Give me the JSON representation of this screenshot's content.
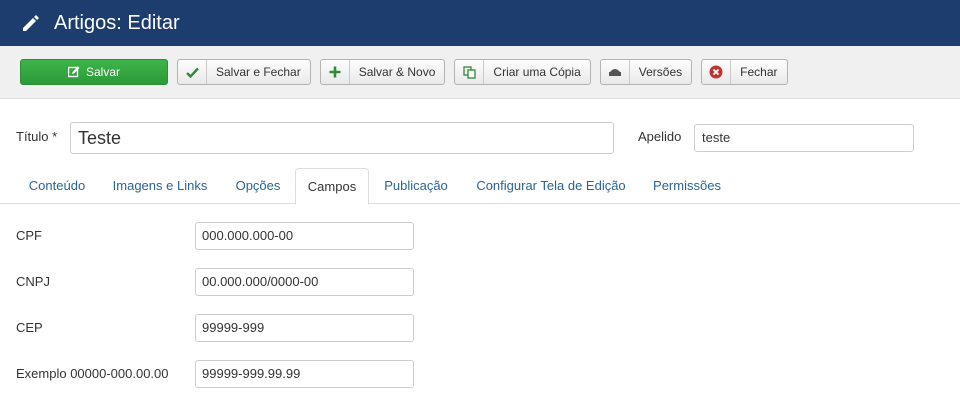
{
  "header": {
    "title": "Artigos: Editar",
    "icon": "pencil-icon"
  },
  "toolbar": {
    "save": "Salvar",
    "save_close": "Salvar e Fechar",
    "save_new": "Salvar & Novo",
    "save_copy": "Criar uma Cópia",
    "versions": "Versões",
    "close": "Fechar"
  },
  "form": {
    "title_label": "Título *",
    "title_value": "Teste",
    "alias_label": "Apelido",
    "alias_value": "teste"
  },
  "tabs": [
    {
      "label": "Conteúdo"
    },
    {
      "label": "Imagens e Links"
    },
    {
      "label": "Opções"
    },
    {
      "label": "Campos",
      "active": true
    },
    {
      "label": "Publicação"
    },
    {
      "label": "Configurar Tela de Edição"
    },
    {
      "label": "Permissões"
    }
  ],
  "fields": [
    {
      "label": "CPF",
      "value": "000.000.000-00"
    },
    {
      "label": "CNPJ",
      "value": "00.000.000/0000-00"
    },
    {
      "label": "CEP",
      "value": "99999-999"
    },
    {
      "label": "Exemplo 00000-000.00.00",
      "value": "99999-999.99.99"
    }
  ],
  "colors": {
    "header": "#1c3d6e",
    "save": "#3eb44a",
    "link": "#2a6496"
  }
}
